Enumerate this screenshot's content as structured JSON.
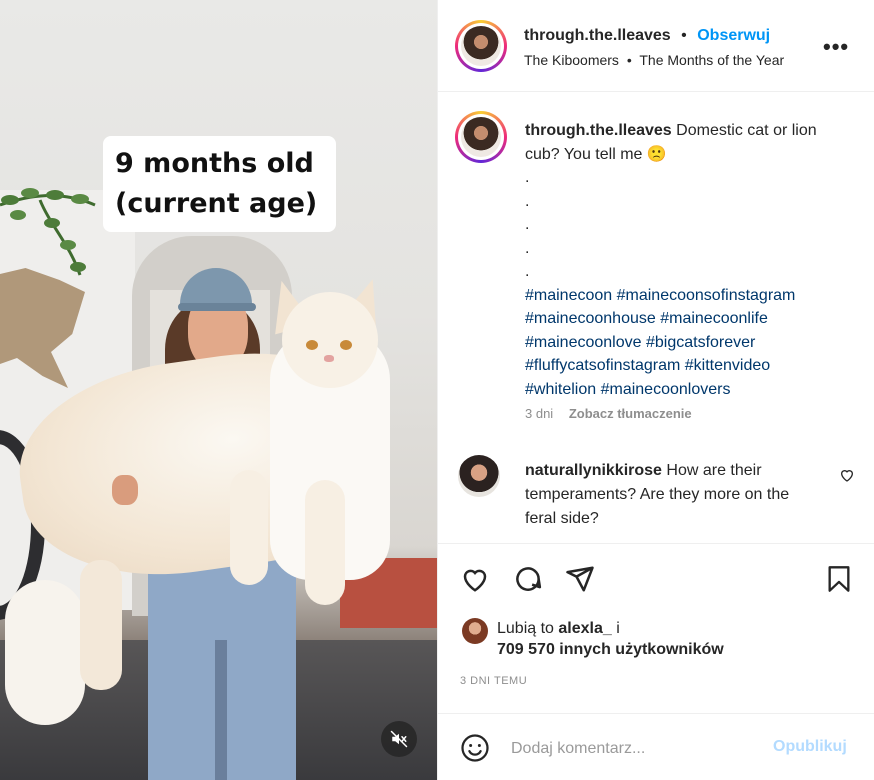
{
  "media": {
    "caption_line1": "9 months old",
    "caption_line2": "(current age)",
    "mute_icon": "speaker-muted-icon"
  },
  "header": {
    "username": "through.the.lleaves",
    "separator": "•",
    "follow_label": "Obserwuj",
    "audio_artist": "The Kiboomers",
    "audio_title": "The Months of the Year",
    "more_label": "•••"
  },
  "post_caption": {
    "username": "through.the.lleaves",
    "text": "Domestic cat or lion cub? You tell me",
    "emoji": "🙁",
    "dots": [
      ".",
      ".",
      ".",
      ".",
      "."
    ],
    "hashtags_line1": "#mainecoon #mainecoonsofinstagram",
    "hashtags_line2": "#mainecoonhouse #mainecoonlife",
    "hashtags_line3": "#mainecoonlove #bigcatsforever",
    "hashtags_line4": "#fluffycatsofinstagram #kittenvideo",
    "hashtags_line5": "#whitelion #mainecoonlovers",
    "age": "3 dni",
    "translate_label": "Zobacz tłumaczenie"
  },
  "comment": {
    "username": "naturallynikkirose",
    "text": "How are their temperaments? Are they more on the feral side?"
  },
  "likes": {
    "prefix": "Lubią to",
    "user": "alexla_",
    "suffix": "i",
    "count_text": "709 570 innych użytkowników"
  },
  "timestamp": "3 DNI TEMU",
  "add_comment": {
    "placeholder": "Dodaj komentarz...",
    "post_label": "Opublikuj"
  },
  "colors": {
    "link_blue": "#0095f6",
    "hashtag": "#00376b",
    "muted_text": "#8e8e8e",
    "post_disabled": "#b3dbff"
  }
}
